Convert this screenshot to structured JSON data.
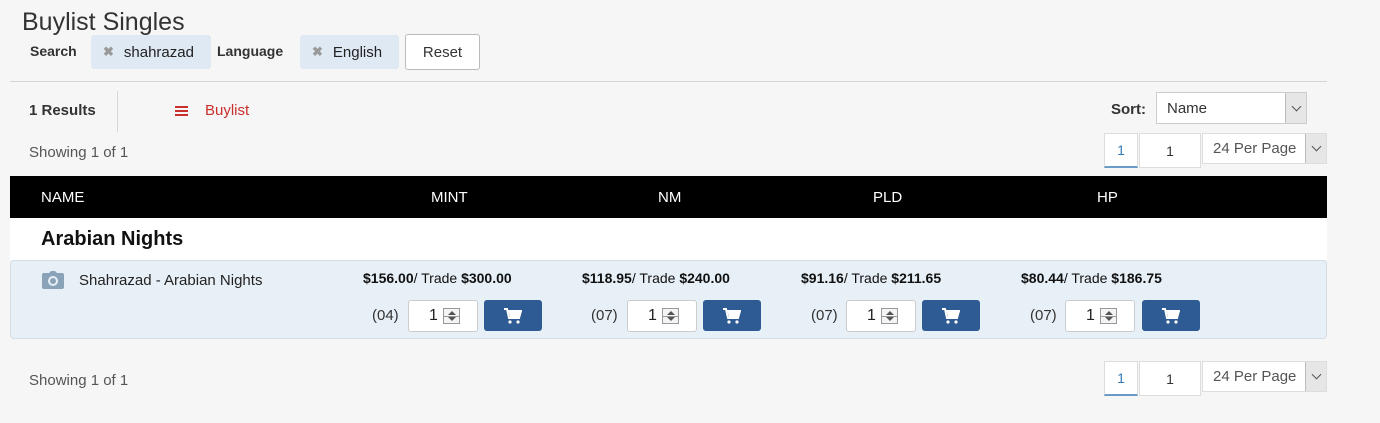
{
  "page": {
    "title": "Buylist Singles"
  },
  "filters": {
    "search_label": "Search",
    "search_value": "shahrazad",
    "language_label": "Language",
    "language_value": "English",
    "reset_label": "Reset"
  },
  "results": {
    "count_text": "1 Results",
    "buylist_label": "Buylist",
    "sort_label": "Sort:",
    "sort_value": "Name",
    "showing_text": "Showing 1 of 1",
    "page_current": "1",
    "page_input": "1",
    "per_page": "24 Per Page"
  },
  "table": {
    "headers": [
      "NAME",
      "MINT",
      "NM",
      "PLD",
      "HP"
    ],
    "group": "Arabian Nights",
    "product": {
      "name": "Shahrazad - Arabian Nights",
      "conditions": [
        {
          "cash": "$156.00",
          "sep": "/ Trade ",
          "trade": "$300.00",
          "available": "(04)",
          "qty": "1"
        },
        {
          "cash": "$118.95",
          "sep": "/ Trade ",
          "trade": "$240.00",
          "available": "(07)",
          "qty": "1"
        },
        {
          "cash": "$91.16",
          "sep": "/ Trade ",
          "trade": "$211.65",
          "available": "(07)",
          "qty": "1"
        },
        {
          "cash": "$80.44",
          "sep": "/ Trade ",
          "trade": "$186.75",
          "available": "(07)",
          "qty": "1"
        }
      ]
    }
  },
  "colors": {
    "accent_red": "#c9302c",
    "button_blue": "#2e5b94",
    "header_black": "#000000",
    "row_bg": "#e8f0f7"
  },
  "icons": [
    "remove-icon",
    "menu-icon",
    "camera-icon",
    "cart-icon",
    "chevron-down-icon"
  ]
}
